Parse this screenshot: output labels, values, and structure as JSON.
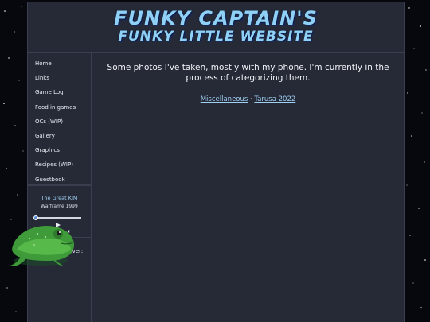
{
  "site": {
    "title_line1": "FUNKY CAPTAIN'S",
    "title_line2": "FUNKY LITTLE WEBSITE"
  },
  "nav": {
    "items": [
      "Home",
      "Links",
      "Game Log",
      "Food in games",
      "OCs (WIP)",
      "Gallery",
      "Graphics",
      "Recipes (WIP)",
      "Guestbook"
    ]
  },
  "player": {
    "song": "The Great KIM",
    "artist": "Warframe 1999",
    "progress": 0.02,
    "play_icon": "play-icon",
    "repeat_icon": "repeat-icon",
    "volume_icon": "volume-icon"
  },
  "gif": {
    "label": "GIF of whenever:"
  },
  "main": {
    "intro": "Some photos I've taken, mostly with my phone. I'm currently in the process of categorizing them.",
    "gallery_links": [
      "Miscellaneous",
      "Tarusa 2022"
    ],
    "separator": "·"
  },
  "colors": {
    "background": "#07080d",
    "panel": "#262a37",
    "accent": "#8fd0f6",
    "link": "#9fd0f4"
  }
}
